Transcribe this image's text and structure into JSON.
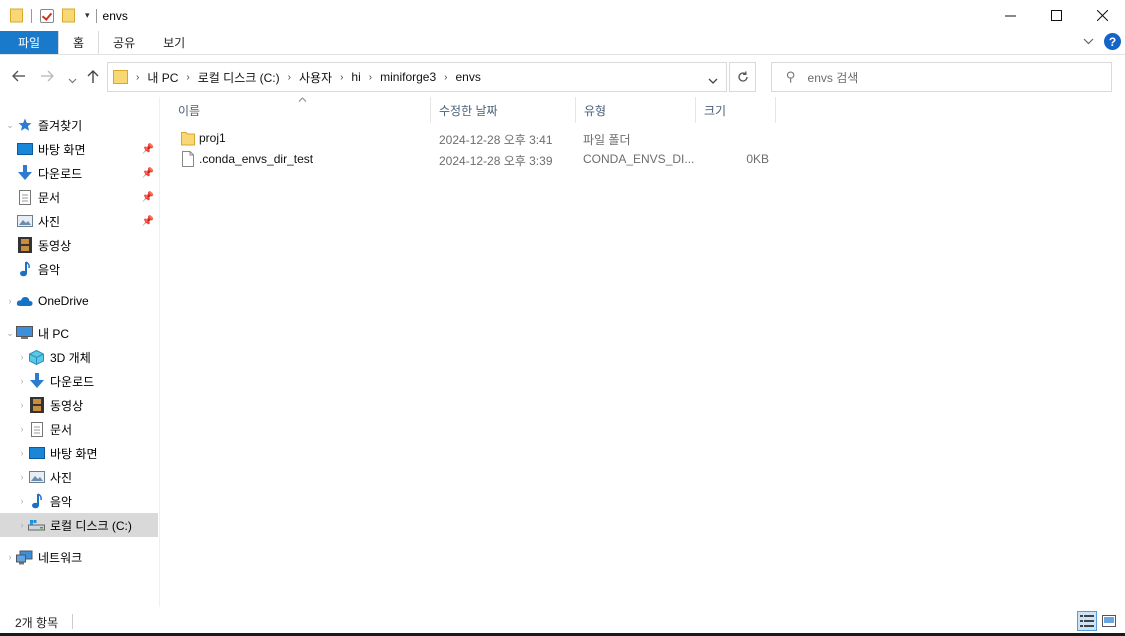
{
  "window": {
    "title": "envs",
    "controls": {
      "minimize": "—",
      "maximize": "☐",
      "close": "✕"
    }
  },
  "ribbon": {
    "tabs": [
      {
        "label": "파일"
      },
      {
        "label": "홈"
      },
      {
        "label": "공유"
      },
      {
        "label": "보기"
      }
    ]
  },
  "address": {
    "crumbs": [
      "내 PC",
      "로컬 디스크 (C:)",
      "사용자",
      "hi",
      "miniforge3",
      "envs"
    ]
  },
  "search": {
    "placeholder": "envs 검색"
  },
  "navpane": {
    "quick_access": "즐겨찾기",
    "quick_items": [
      "바탕 화면",
      "다운로드",
      "문서",
      "사진",
      "동영상",
      "음악"
    ],
    "onedrive": "OneDrive",
    "this_pc": "내 PC",
    "pc_items": [
      "3D 개체",
      "다운로드",
      "동영상",
      "문서",
      "바탕 화면",
      "사진",
      "음악",
      "로컬 디스크 (C:)"
    ],
    "network": "네트워크"
  },
  "columns": {
    "name": "이름",
    "date": "수정한 날짜",
    "type": "유형",
    "size": "크기"
  },
  "files": [
    {
      "name": "proj1",
      "date": "2024-12-28 오후 3:41",
      "type": "파일 폴더",
      "size": ""
    },
    {
      "name": ".conda_envs_dir_test",
      "date": "2024-12-28 오후 3:39",
      "type": "CONDA_ENVS_DI...",
      "size": "0KB"
    }
  ],
  "status": {
    "count": "2개 항목"
  },
  "colors": {
    "accent": "#1979ca",
    "folder": "#f8d775",
    "selected": "#d9d9d9"
  }
}
